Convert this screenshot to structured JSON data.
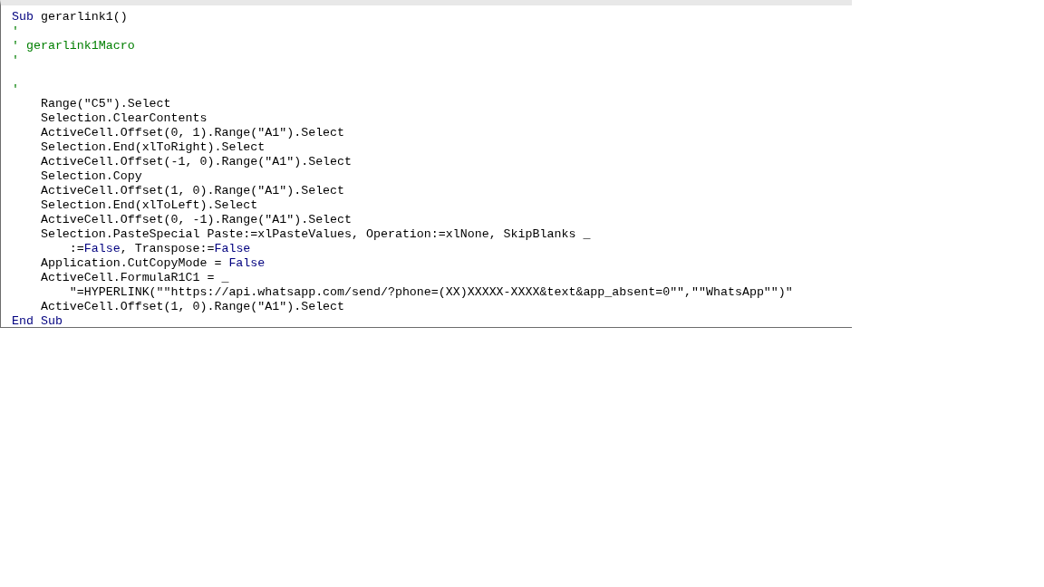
{
  "code_lines": [
    {
      "segments": [
        {
          "kind": "keyword",
          "text": "Sub"
        },
        {
          "kind": "code",
          "text": " gerarlink1()"
        }
      ]
    },
    {
      "segments": [
        {
          "kind": "comment",
          "text": "'"
        }
      ]
    },
    {
      "segments": [
        {
          "kind": "comment",
          "text": "' gerarlink1Macro"
        }
      ]
    },
    {
      "segments": [
        {
          "kind": "comment",
          "text": "'"
        }
      ]
    },
    {
      "blank": true
    },
    {
      "segments": [
        {
          "kind": "comment",
          "text": "'"
        }
      ]
    },
    {
      "segments": [
        {
          "kind": "code",
          "text": "    Range(\"C5\").Select"
        }
      ]
    },
    {
      "segments": [
        {
          "kind": "code",
          "text": "    Selection.ClearContents"
        }
      ]
    },
    {
      "segments": [
        {
          "kind": "code",
          "text": "    ActiveCell.Offset(0, 1).Range(\"A1\").Select"
        }
      ]
    },
    {
      "segments": [
        {
          "kind": "code",
          "text": "    Selection.End(xlToRight).Select"
        }
      ]
    },
    {
      "segments": [
        {
          "kind": "code",
          "text": "    ActiveCell.Offset(-1, 0).Range(\"A1\").Select"
        }
      ]
    },
    {
      "segments": [
        {
          "kind": "code",
          "text": "    Selection.Copy"
        }
      ]
    },
    {
      "segments": [
        {
          "kind": "code",
          "text": "    ActiveCell.Offset(1, 0).Range(\"A1\").Select"
        }
      ]
    },
    {
      "segments": [
        {
          "kind": "code",
          "text": "    Selection.End(xlToLeft).Select"
        }
      ]
    },
    {
      "segments": [
        {
          "kind": "code",
          "text": "    ActiveCell.Offset(0, -1).Range(\"A1\").Select"
        }
      ]
    },
    {
      "segments": [
        {
          "kind": "code",
          "text": "    Selection.PasteSpecial Paste:=xlPasteValues, Operation:=xlNone, SkipBlanks _"
        }
      ]
    },
    {
      "segments": [
        {
          "kind": "code",
          "text": "        :="
        },
        {
          "kind": "keyword",
          "text": "False"
        },
        {
          "kind": "code",
          "text": ", Transpose:="
        },
        {
          "kind": "keyword",
          "text": "False"
        }
      ]
    },
    {
      "segments": [
        {
          "kind": "code",
          "text": "    Application.CutCopyMode = "
        },
        {
          "kind": "keyword",
          "text": "False"
        }
      ]
    },
    {
      "segments": [
        {
          "kind": "code",
          "text": "    ActiveCell.FormulaR1C1 = _"
        }
      ]
    },
    {
      "segments": [
        {
          "kind": "code",
          "text": "        \"=HYPERLINK(\"\"https://api.whatsapp.com/send/?phone=(XX)XXXXX-XXXX&text&app_absent=0\"\",\"\"WhatsApp\"\")\""
        }
      ]
    },
    {
      "segments": [
        {
          "kind": "code",
          "text": "    ActiveCell.Offset(1, 0).Range(\"A1\").Select"
        }
      ]
    },
    {
      "segments": [
        {
          "kind": "keyword",
          "text": "End Sub"
        }
      ]
    }
  ]
}
